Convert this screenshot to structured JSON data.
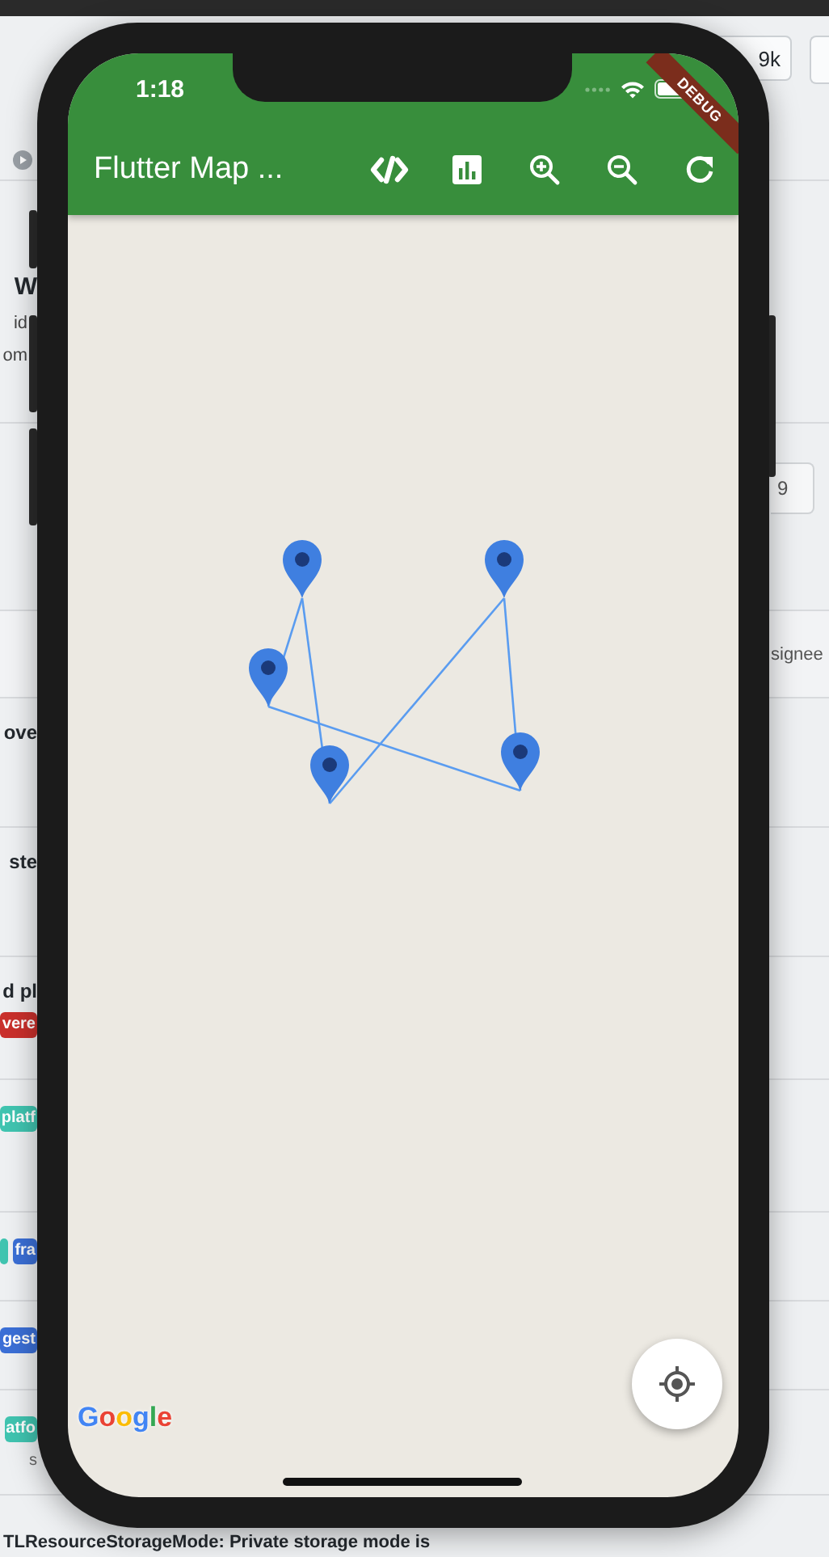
{
  "background_page": {
    "star_count": "9k",
    "heading": "W",
    "text_lines": [
      "id",
      "om"
    ],
    "counter": "9",
    "filter_label": "signee",
    "issues": [
      {
        "title": "ove"
      },
      {
        "title": "ste"
      },
      {
        "title": "d pl",
        "labels": [
          {
            "text": "vere",
            "color": "#c9302c"
          }
        ]
      },
      {
        "labels": [
          {
            "text": "platf",
            "color": "#40c4b0"
          }
        ]
      },
      {
        "labels": [
          {
            "color": "#40c4b0"
          },
          {
            "text": "fra",
            "color": "#3b6fd6"
          }
        ]
      },
      {
        "labels": [
          {
            "text": "gest",
            "color": "#3b6fd6"
          }
        ]
      },
      {
        "labels": [
          {
            "text": "atfo",
            "color": "#40c4b0"
          }
        ],
        "meta": "s"
      },
      {
        "title": "TLResourceStorageMode: Private storage mode is"
      }
    ]
  },
  "phone": {
    "status_bar": {
      "time": "1:18"
    },
    "debug_banner": "DEBUG",
    "app_bar": {
      "title": "Flutter Map ...",
      "actions": [
        {
          "kind": "code"
        },
        {
          "kind": "chart"
        },
        {
          "kind": "zoom_in"
        },
        {
          "kind": "zoom_out"
        },
        {
          "kind": "refresh"
        }
      ]
    },
    "map": {
      "attribution": "Google"
    }
  }
}
